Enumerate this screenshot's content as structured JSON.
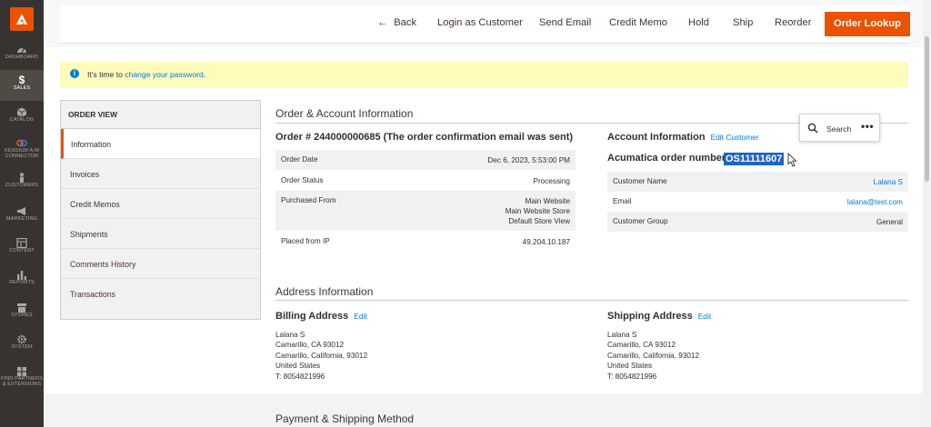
{
  "nav": {
    "items": [
      {
        "label": "DASHBOARD",
        "icon": "speedometer-icon"
      },
      {
        "label": "SALES",
        "icon": "dollar-icon"
      },
      {
        "label": "CATALOG",
        "icon": "cube-icon"
      },
      {
        "label": "KENSIUM A-M CONNECTOR",
        "icon": "connector-icon"
      },
      {
        "label": "CUSTOMERS",
        "icon": "person-icon"
      },
      {
        "label": "MARKETING",
        "icon": "megaphone-icon"
      },
      {
        "label": "CONTENT",
        "icon": "layout-icon"
      },
      {
        "label": "REPORTS",
        "icon": "bar-chart-icon"
      },
      {
        "label": "STORES",
        "icon": "store-icon"
      },
      {
        "label": "SYSTEM",
        "icon": "gear-icon"
      },
      {
        "label": "FIND PARTNERS & EXTENSIONS",
        "icon": "blocks-icon"
      }
    ]
  },
  "toolbar": {
    "back": "Back",
    "login_as_customer": "Login as Customer",
    "send_email": "Send Email",
    "credit_memo": "Credit Memo",
    "hold": "Hold",
    "ship": "Ship",
    "reorder": "Reorder",
    "order_lookup": "Order Lookup"
  },
  "notice": {
    "prefix": "It's time to ",
    "link": "change your password",
    "suffix": "."
  },
  "order_view": {
    "heading": "ORDER VIEW",
    "tabs": [
      "Information",
      "Invoices",
      "Credit Memos",
      "Shipments",
      "Comments History",
      "Transactions"
    ],
    "active_tab": "Information"
  },
  "order_account": {
    "section_title": "Order & Account Information",
    "order_heading": "Order # 244000000685 (The order confirmation email was sent)",
    "rows": [
      {
        "label": "Order Date",
        "value": "Dec 6, 2023, 5:53:00 PM"
      },
      {
        "label": "Order Status",
        "value": "Processing"
      },
      {
        "label": "Purchased From",
        "value": [
          "Main Website",
          "Main Website Store",
          "Default Store View"
        ]
      },
      {
        "label": "Placed from IP",
        "value": "49.204.10.187"
      }
    ],
    "account_heading": "Account Information",
    "edit_customer": "Edit Customer",
    "acumatica_label": "Acumatica order number:",
    "acumatica_number": "OS11111607",
    "account_rows": [
      {
        "label": "Customer Name",
        "value": "Lalana S"
      },
      {
        "label": "Email",
        "value": "lalana@test.com"
      },
      {
        "label": "Customer Group",
        "value": "General"
      }
    ]
  },
  "address": {
    "section_title": "Address Information",
    "billing_heading": "Billing Address",
    "shipping_heading": "Shipping Address",
    "edit": "Edit",
    "billing_lines": [
      "Lalana S",
      "Camarillo, CA 93012",
      "Camarillo, California, 93012",
      "United States",
      "T: 8054821996"
    ],
    "shipping_lines": [
      "Lalana S",
      "Camarillo, CA 93012",
      "Camarillo, California, 93012",
      "United States",
      "T: 8054821996"
    ]
  },
  "payment": {
    "section_title": "Payment & Shipping Method"
  },
  "search_popup": {
    "label": "Search",
    "more": "•••"
  },
  "colors": {
    "accent": "#eb5202",
    "link": "#007bdb",
    "nav_bg": "#373330",
    "notice_bg": "#fffbbb",
    "selection": "#1d63c9"
  }
}
